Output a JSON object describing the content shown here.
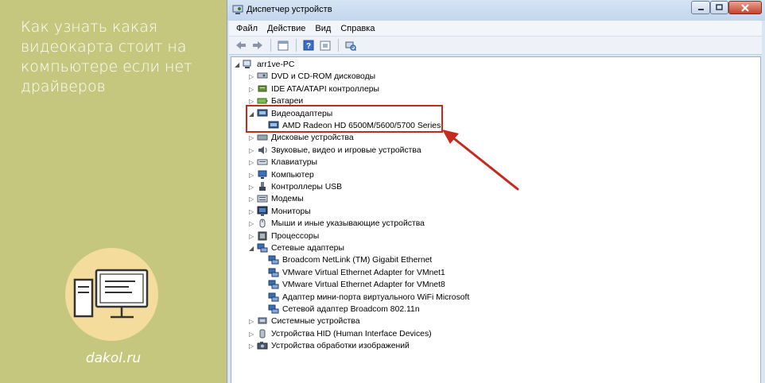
{
  "article": {
    "title": "Как узнать какая видеокарта стоит на компьютере если нет драйверов",
    "site": "dakol.ru"
  },
  "window": {
    "title": "Диспетчер устройств",
    "icon": "device-manager-icon"
  },
  "menu": [
    "Файл",
    "Действие",
    "Вид",
    "Справка"
  ],
  "toolbar": [
    "back-arrow-icon",
    "forward-arrow-icon",
    "properties-icon",
    "help-icon",
    "show-hidden-icon",
    "scan-hardware-icon"
  ],
  "tree": {
    "root": "arr1ve-PC",
    "items": [
      {
        "label": "DVD и CD-ROM дисководы",
        "icon": "dvd-drive-icon",
        "level": 1,
        "expanded": false
      },
      {
        "label": "IDE ATA/ATAPI контроллеры",
        "icon": "ide-controller-icon",
        "level": 1,
        "expanded": false
      },
      {
        "label": "Батареи",
        "icon": "battery-icon",
        "level": 1,
        "expanded": false
      },
      {
        "label": "Видеоадаптеры",
        "icon": "display-adapter-icon",
        "level": 1,
        "expanded": true
      },
      {
        "label": "AMD Radeon HD 6500M/5600/5700 Series",
        "icon": "display-adapter-icon",
        "level": 2
      },
      {
        "label": "Дисковые устройства",
        "icon": "disk-drive-icon",
        "level": 1,
        "expanded": false
      },
      {
        "label": "Звуковые, видео и игровые устройства",
        "icon": "speaker-icon",
        "level": 1,
        "expanded": false
      },
      {
        "label": "Клавиатуры",
        "icon": "keyboard-icon",
        "level": 1,
        "expanded": false
      },
      {
        "label": "Компьютер",
        "icon": "computer-icon",
        "level": 1,
        "expanded": false
      },
      {
        "label": "Контроллеры USB",
        "icon": "usb-icon",
        "level": 1,
        "expanded": false
      },
      {
        "label": "Модемы",
        "icon": "modem-icon",
        "level": 1,
        "expanded": false
      },
      {
        "label": "Мониторы",
        "icon": "monitor-icon",
        "level": 1,
        "expanded": false
      },
      {
        "label": "Мыши и иные указывающие устройства",
        "icon": "mouse-icon",
        "level": 1,
        "expanded": false
      },
      {
        "label": "Процессоры",
        "icon": "processor-icon",
        "level": 1,
        "expanded": false
      },
      {
        "label": "Сетевые адаптеры",
        "icon": "network-adapter-icon",
        "level": 1,
        "expanded": true
      },
      {
        "label": "Broadcom NetLink (TM) Gigabit Ethernet",
        "icon": "network-adapter-icon",
        "level": 2
      },
      {
        "label": "VMware Virtual Ethernet Adapter for VMnet1",
        "icon": "network-adapter-icon",
        "level": 2
      },
      {
        "label": "VMware Virtual Ethernet Adapter for VMnet8",
        "icon": "network-adapter-icon",
        "level": 2
      },
      {
        "label": "Адаптер мини-порта виртуального WiFi Microsoft",
        "icon": "network-adapter-icon",
        "level": 2
      },
      {
        "label": "Сетевой адаптер Broadcom 802.11n",
        "icon": "network-adapter-icon",
        "level": 2
      },
      {
        "label": "Системные устройства",
        "icon": "system-device-icon",
        "level": 1,
        "expanded": false
      },
      {
        "label": "Устройства HID (Human Interface Devices)",
        "icon": "hid-icon",
        "level": 1,
        "expanded": false
      },
      {
        "label": "Устройства обработки изображений",
        "icon": "camera-icon",
        "level": 1,
        "expanded": false
      }
    ]
  },
  "colors": {
    "panel": "#c6c77e",
    "highlight": "#c62a1f",
    "window_frame": "#dbe6f3"
  }
}
